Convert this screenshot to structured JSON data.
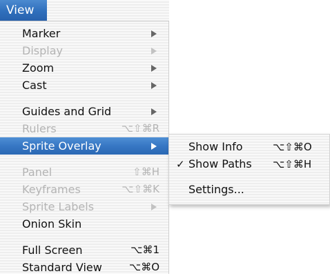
{
  "menubar": {
    "title": "View"
  },
  "menu": {
    "items": [
      {
        "label": "Marker",
        "shortcut": "",
        "submenu": true,
        "enabled": true
      },
      {
        "label": "Display",
        "shortcut": "",
        "submenu": true,
        "enabled": false
      },
      {
        "label": "Zoom",
        "shortcut": "",
        "submenu": true,
        "enabled": true
      },
      {
        "label": "Cast",
        "shortcut": "",
        "submenu": true,
        "enabled": true
      },
      {
        "label": "Guides and Grid",
        "shortcut": "",
        "submenu": true,
        "enabled": true
      },
      {
        "label": "Rulers",
        "shortcut": "⌥⇧⌘R",
        "submenu": false,
        "enabled": false
      },
      {
        "label": "Sprite Overlay",
        "shortcut": "",
        "submenu": true,
        "enabled": true,
        "selected": true
      },
      {
        "label": "Panel",
        "shortcut": "⇧⌘H",
        "submenu": false,
        "enabled": false
      },
      {
        "label": "Keyframes",
        "shortcut": "⌥⇧⌘K",
        "submenu": false,
        "enabled": false
      },
      {
        "label": "Sprite Labels",
        "shortcut": "",
        "submenu": true,
        "enabled": false
      },
      {
        "label": "Onion Skin",
        "shortcut": "",
        "submenu": false,
        "enabled": true
      },
      {
        "label": "Full Screen",
        "shortcut": "⌥⌘1",
        "submenu": false,
        "enabled": true
      },
      {
        "label": "Standard View",
        "shortcut": "⌥⌘O",
        "submenu": false,
        "enabled": true
      }
    ]
  },
  "submenu": {
    "items": [
      {
        "label": "Show Info",
        "shortcut": "⌥⇧⌘O",
        "checked": false
      },
      {
        "label": "Show Paths",
        "shortcut": "⌥⇧⌘H",
        "checked": true,
        "check_mark": "✓"
      },
      {
        "label": "Settings...",
        "shortcut": "",
        "checked": false
      }
    ]
  },
  "colors": {
    "selection": "#3777c4",
    "disabled_text": "#b4b4b4",
    "text": "#111111"
  }
}
